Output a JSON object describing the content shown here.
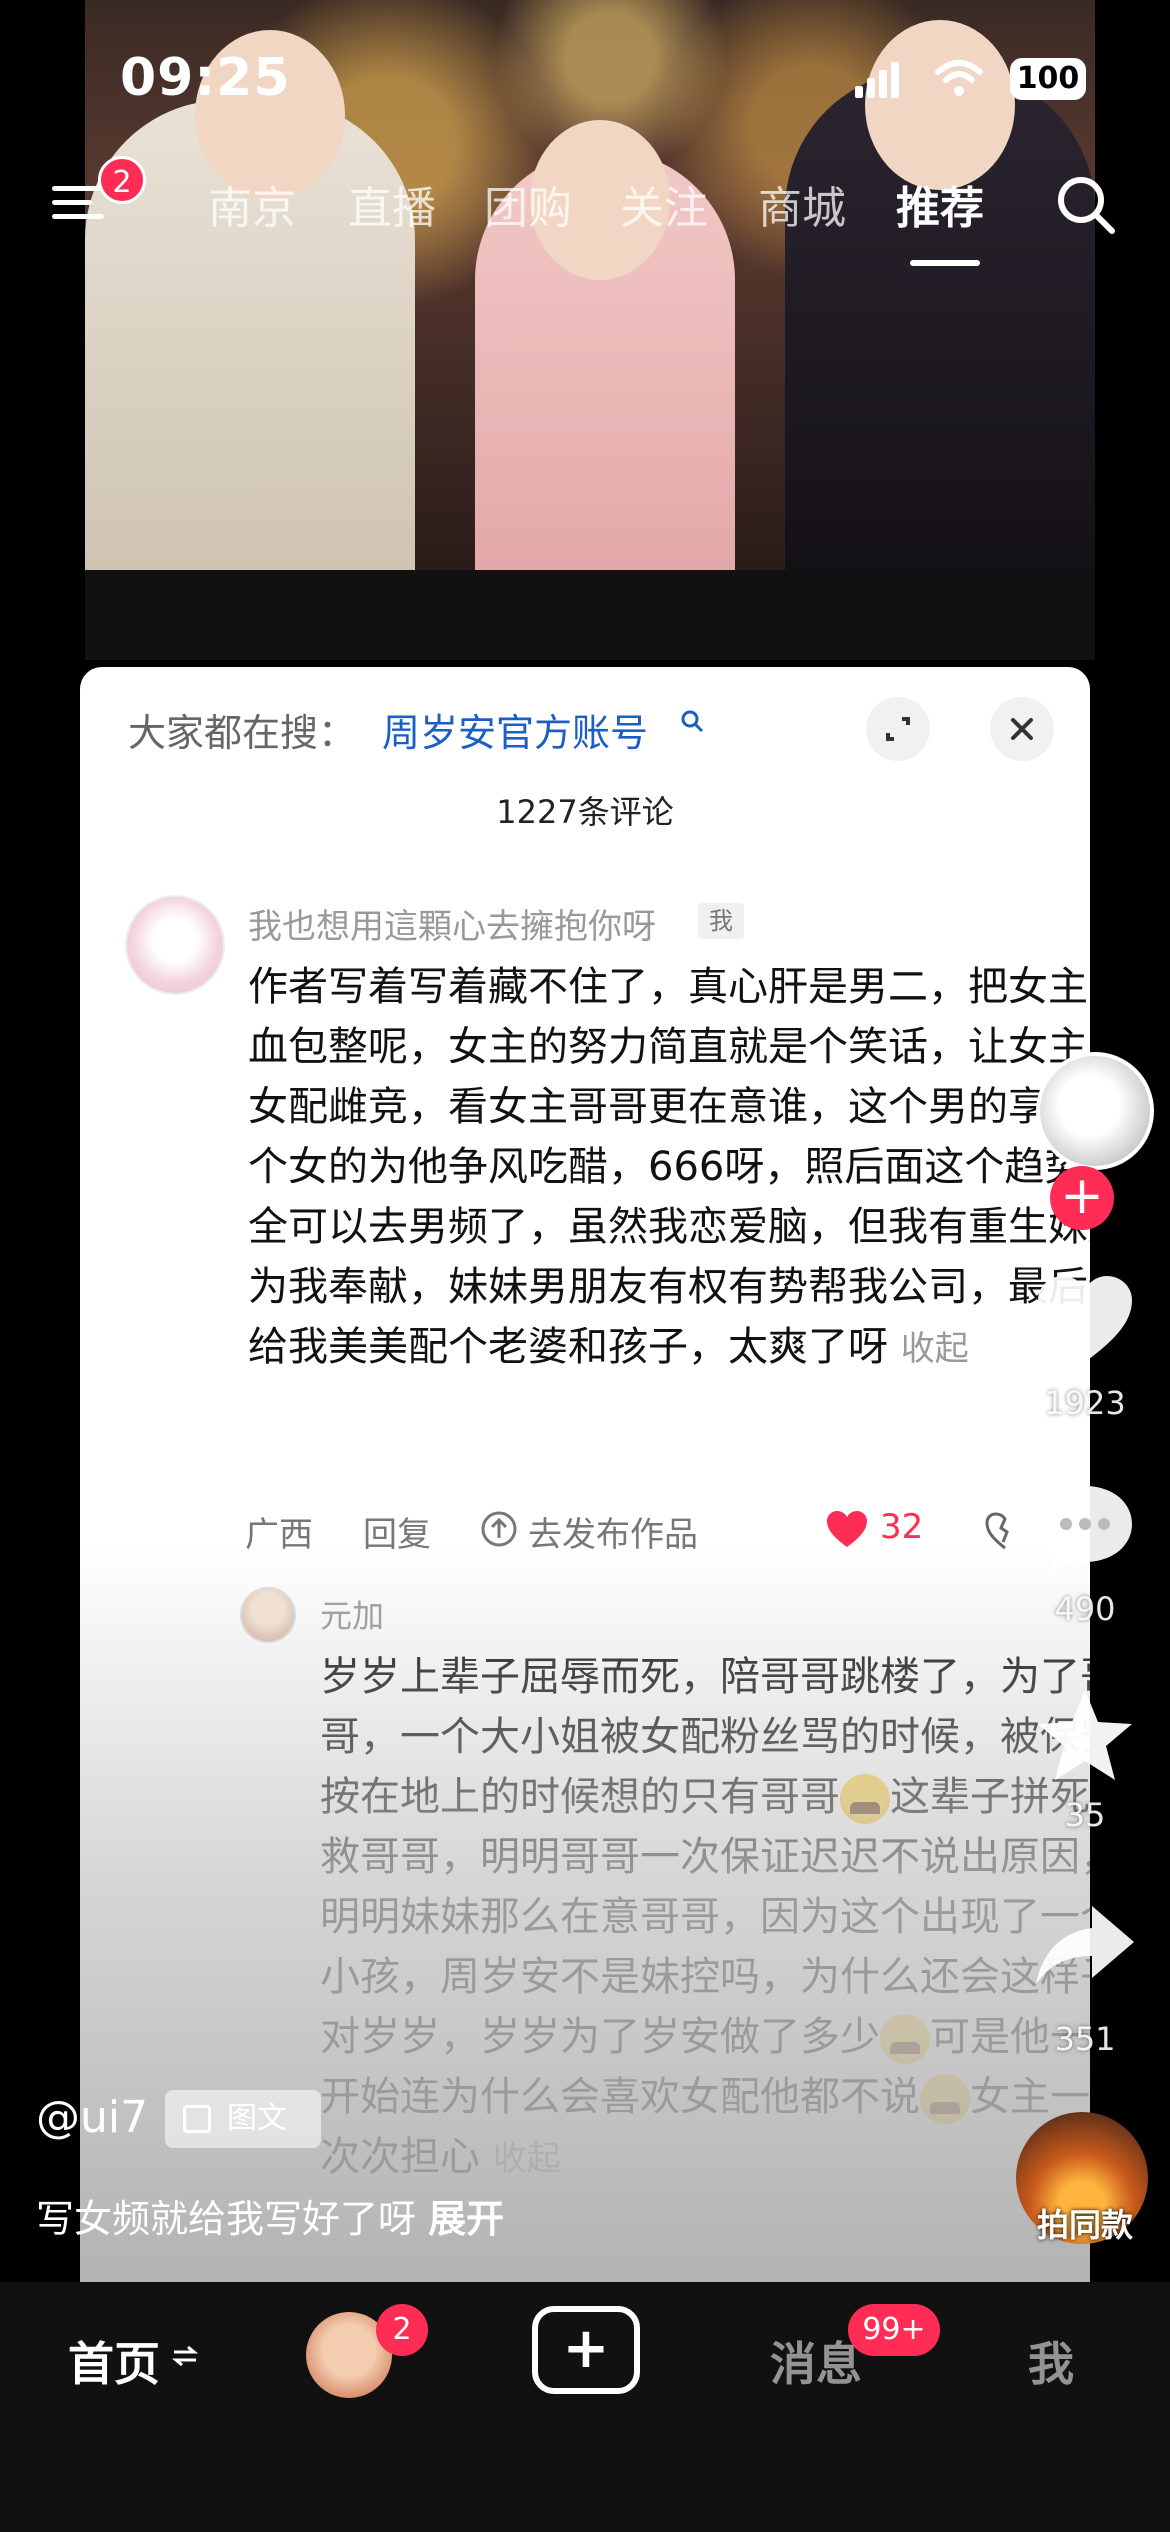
{
  "status_bar": {
    "time": "09:25",
    "battery": "100"
  },
  "top_nav": {
    "menu_badge": "2",
    "tabs": [
      "南京",
      "直播",
      "团购",
      "关注",
      "商城",
      "推荐"
    ],
    "active_tab": "推荐"
  },
  "comments_panel": {
    "search_hint": "大家都在搜：",
    "search_link": "周岁安官方账号",
    "count_text": "1227条评论",
    "comment1": {
      "author": "我也想用這顆心去擁抱你呀",
      "me_tag": "我",
      "text": "作者写着写着藏不住了，真心肝是男二，把女主当血包整呢，女主的努力简直就是个笑话，让女主和女配雌竞，看女主哥哥更在意谁，这个男的享受两个女的为他争风吃醋，666呀，照后面这个趋势完全可以去男频了，虽然我恋爱脑，但我有重生妹妹为我奉献，妹妹男朋友有权有势帮我公司，最后还给我美美配个老婆和孩子，太爽了呀",
      "collapse": "收起",
      "location": "广西",
      "reply": "回复",
      "publish": "去发布作品",
      "likes": "32"
    },
    "comment2": {
      "author": "元加",
      "text_a": "岁岁上辈子屈辱而死，陪哥哥跳楼了，为了哥哥，一个大小姐被女配粉丝骂的时候，被保安按在地上的时候想的只有哥哥",
      "text_b": "这辈子拼死救哥哥，明明哥哥一次保证迟迟不说出原因，明明妹妹那么在意哥哥，因为这个出现了一个小孩，周岁安不是妹控吗，为什么还会这样子对岁岁，岁岁为了岁安做了多少",
      "text_c": "可是他一开始连为什么会喜欢女配他都不说",
      "text_d": "女主一次次担心",
      "collapse": "收起"
    }
  },
  "side_actions": {
    "likes": "1923",
    "comments": "490",
    "favorites": "35",
    "shares": "351",
    "music_label": "拍同款"
  },
  "post": {
    "author": "@ui7",
    "type_tag": "图文",
    "caption": "写女频就给我写好了呀",
    "expand": "展开"
  },
  "bottom_nav": {
    "home": "首页",
    "friends_badge": "2",
    "create": "+",
    "messages": "消息",
    "messages_badge": "99+",
    "me": "我"
  },
  "colors": {
    "accent": "#ff2d55",
    "link": "#1b5fc4"
  }
}
